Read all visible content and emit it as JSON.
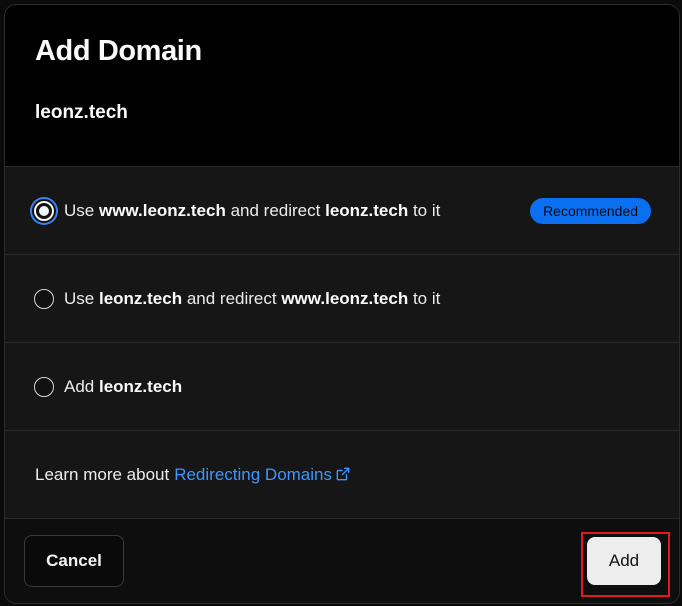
{
  "dialog": {
    "title": "Add Domain",
    "domain": "leonz.tech"
  },
  "options": [
    {
      "selected": true,
      "parts": [
        "Use ",
        "www.leonz.tech",
        " and redirect ",
        "leonz.tech",
        " to it"
      ],
      "badge": "Recommended"
    },
    {
      "selected": false,
      "parts": [
        "Use ",
        "leonz.tech",
        " and redirect ",
        "www.leonz.tech",
        " to it"
      ]
    },
    {
      "selected": false,
      "parts": [
        "Add ",
        "leonz.tech"
      ]
    }
  ],
  "learn_more": {
    "prefix": "Learn more about",
    "link": "Redirecting Domains",
    "icon": "external-link-icon"
  },
  "footer": {
    "cancel_label": "Cancel",
    "add_label": "Add"
  },
  "colors": {
    "accent": "#0a6ff0",
    "link": "#3f95ff",
    "highlight": "#e01b1b"
  }
}
